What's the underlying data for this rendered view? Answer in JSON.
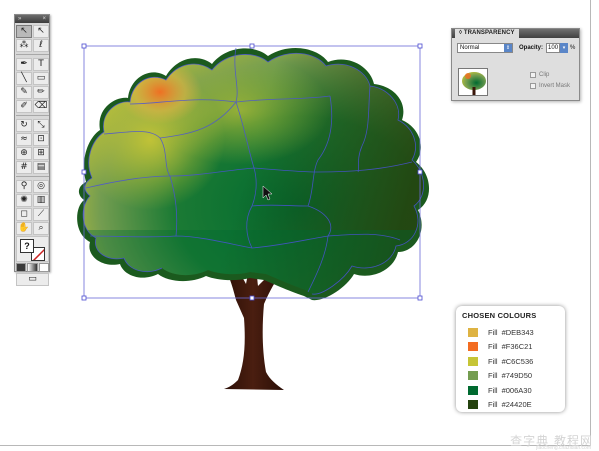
{
  "tools": {
    "items": [
      {
        "name": "selection-tool",
        "glyph": "↖"
      },
      {
        "name": "direct-selection-tool",
        "glyph": "↖"
      },
      {
        "name": "magic-wand-tool",
        "glyph": "⁂"
      },
      {
        "name": "lasso-tool",
        "glyph": "ℓ"
      },
      {
        "name": "pen-tool",
        "glyph": "✒"
      },
      {
        "name": "type-tool",
        "glyph": "T"
      },
      {
        "name": "line-segment-tool",
        "glyph": "╲"
      },
      {
        "name": "rectangle-tool",
        "glyph": "▭"
      },
      {
        "name": "paintbrush-tool",
        "glyph": "✎"
      },
      {
        "name": "pencil-tool",
        "glyph": "✏"
      },
      {
        "name": "blob-brush-tool",
        "glyph": "✐"
      },
      {
        "name": "eraser-tool",
        "glyph": "⌫"
      },
      {
        "name": "rotate-tool",
        "glyph": "↻"
      },
      {
        "name": "scale-tool",
        "glyph": "⤡"
      },
      {
        "name": "warp-tool",
        "glyph": "≈"
      },
      {
        "name": "free-transform-tool",
        "glyph": "⊡"
      },
      {
        "name": "shape-builder-tool",
        "glyph": "⊕"
      },
      {
        "name": "perspective-grid-tool",
        "glyph": "⊞"
      },
      {
        "name": "mesh-tool",
        "glyph": "#"
      },
      {
        "name": "gradient-tool",
        "glyph": "▤"
      },
      {
        "name": "eyedropper-tool",
        "glyph": "⚲"
      },
      {
        "name": "blend-tool",
        "glyph": "◎"
      },
      {
        "name": "symbol-sprayer-tool",
        "glyph": "✺"
      },
      {
        "name": "column-graph-tool",
        "glyph": "▥"
      },
      {
        "name": "artboard-tool",
        "glyph": "◻"
      },
      {
        "name": "slice-tool",
        "glyph": "⟋"
      },
      {
        "name": "hand-tool",
        "glyph": "✋"
      },
      {
        "name": "zoom-tool",
        "glyph": "⌕"
      }
    ],
    "fill_glyph": "?",
    "stroke_color": "#cc2222"
  },
  "transparency": {
    "tab_label": "TRANSPARENCY",
    "blend_mode": "Normal",
    "opacity_label": "Opacity:",
    "opacity_value": "100",
    "opacity_unit": "%",
    "clip_label": "Clip",
    "invert_mask_label": "Invert Mask"
  },
  "chosen_colours": {
    "title": "CHOSEN COLOURS",
    "fill_label": "Fill",
    "items": [
      {
        "hex": "#DEB343",
        "color": "#DEB343"
      },
      {
        "hex": "#F36C21",
        "color": "#F36C21"
      },
      {
        "hex": "#C6C536",
        "color": "#C6C536"
      },
      {
        "hex": "#749D50",
        "color": "#749D50"
      },
      {
        "hex": "#006A30",
        "color": "#006A30"
      },
      {
        "hex": "#24420E",
        "color": "#24420E"
      }
    ]
  },
  "watermark": {
    "text": "查字典 教程网",
    "url": "jiaocheng.chazidian.com"
  }
}
